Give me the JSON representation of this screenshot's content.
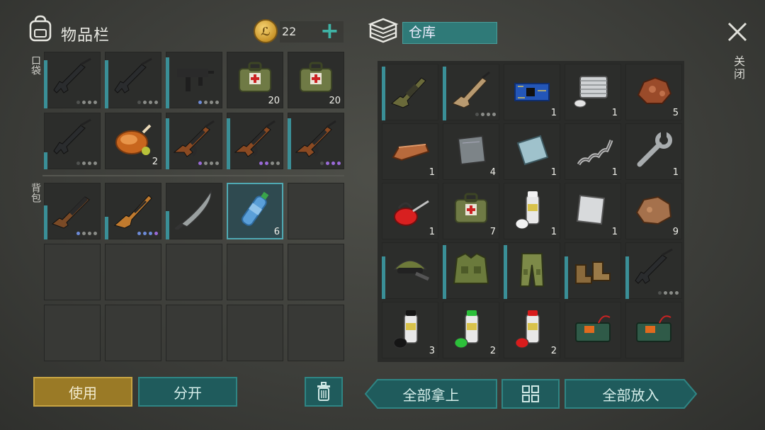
{
  "inventory": {
    "title": "物品栏",
    "coins": "22",
    "pocket_label": "口袋",
    "backpack_label": "背包",
    "pocket_slots": [
      {
        "icon": "assault-rifle-icon",
        "qty": "",
        "dots": [
          "dark",
          "grey",
          "grey",
          "grey"
        ],
        "dur": 0.85
      },
      {
        "icon": "assault-rifle-icon",
        "qty": "",
        "dots": [
          "dark",
          "grey",
          "grey",
          "grey"
        ],
        "dur": 0.85
      },
      {
        "icon": "smg-icon",
        "qty": "",
        "dots": [
          "blue",
          "grey",
          "grey",
          "grey"
        ],
        "dur": 0.9
      },
      {
        "icon": "medkit-bag-icon",
        "qty": "20",
        "dots": [],
        "dur": 0
      },
      {
        "icon": "medkit-bag-icon",
        "qty": "20",
        "dots": [],
        "dur": 0
      },
      {
        "icon": "assault-rifle-icon",
        "qty": "",
        "dots": [
          "dark",
          "grey",
          "grey",
          "grey"
        ],
        "dur": 0.3
      },
      {
        "icon": "roast-chicken-icon",
        "qty": "2",
        "dots": [],
        "dur": 0
      },
      {
        "icon": "ak-rifle-icon",
        "qty": "",
        "dots": [
          "purple",
          "grey",
          "grey",
          "grey"
        ],
        "dur": 0.9
      },
      {
        "icon": "ak-rifle-icon",
        "qty": "",
        "dots": [
          "purple",
          "purple",
          "grey",
          "grey"
        ],
        "dur": 0.9
      },
      {
        "icon": "ak-rifle-icon",
        "qty": "",
        "dots": [
          "dark",
          "purple",
          "purple",
          "purple"
        ],
        "dur": 0.9
      }
    ],
    "backpack_slots": [
      {
        "icon": "shotgun-icon",
        "qty": "",
        "dots": [
          "blue",
          "grey",
          "grey",
          "grey"
        ],
        "dur": 0.6
      },
      {
        "icon": "hunting-rifle-icon",
        "qty": "",
        "dots": [
          "blue",
          "blue",
          "blue",
          "purple"
        ],
        "dur": 0.4
      },
      {
        "icon": "machete-icon",
        "qty": "",
        "dots": [],
        "dur": 0.5
      },
      {
        "icon": "water-bottle-icon",
        "qty": "6",
        "dots": [],
        "dur": 0,
        "selected": true
      },
      {
        "empty": true
      },
      {
        "empty": true
      },
      {
        "empty": true
      },
      {
        "empty": true
      },
      {
        "empty": true
      },
      {
        "empty": true
      },
      {
        "empty": true
      },
      {
        "empty": true
      },
      {
        "empty": true
      },
      {
        "empty": true
      },
      {
        "empty": true
      }
    ]
  },
  "warehouse": {
    "title": "仓库",
    "close_label": "关闭",
    "slots": [
      {
        "icon": "grenade-launcher-rifle-icon",
        "qty": "",
        "dots": [],
        "dur": 0.95
      },
      {
        "icon": "scar-rifle-icon",
        "qty": "",
        "dots": [
          "dark",
          "grey",
          "grey",
          "grey"
        ],
        "dur": 0.95
      },
      {
        "icon": "circuit-board-icon",
        "qty": "1",
        "dots": [],
        "dur": 0
      },
      {
        "icon": "engine-part-icon",
        "qty": "1",
        "dots": [],
        "dur": 0
      },
      {
        "icon": "copper-ore-icon",
        "qty": "5",
        "dots": [],
        "dur": 0
      },
      {
        "icon": "copper-ingot-icon",
        "qty": "1",
        "dots": [],
        "dur": 0
      },
      {
        "icon": "metal-plate-icon",
        "qty": "4",
        "dots": [],
        "dur": 0
      },
      {
        "icon": "glass-plate-icon",
        "qty": "1",
        "dots": [],
        "dur": 0
      },
      {
        "icon": "spring-icon",
        "qty": "1",
        "dots": [],
        "dur": 0
      },
      {
        "icon": "wrench-icon",
        "qty": "1",
        "dots": [],
        "dur": 0
      },
      {
        "icon": "oil-can-icon",
        "qty": "1",
        "dots": [],
        "dur": 0
      },
      {
        "icon": "medkit-bag-icon",
        "qty": "7",
        "dots": [],
        "dur": 0
      },
      {
        "icon": "spray-paint-white-icon",
        "qty": "1",
        "dots": [],
        "dur": 0
      },
      {
        "icon": "steel-sheet-icon",
        "qty": "1",
        "dots": [],
        "dur": 0
      },
      {
        "icon": "iron-ore-icon",
        "qty": "9",
        "dots": [],
        "dur": 0
      },
      {
        "icon": "military-cap-icon",
        "qty": "",
        "dots": [],
        "dur": 0.75
      },
      {
        "icon": "tactical-vest-icon",
        "qty": "",
        "dots": [],
        "dur": 0.95
      },
      {
        "icon": "camo-pants-icon",
        "qty": "",
        "dots": [],
        "dur": 0.95
      },
      {
        "icon": "combat-boots-icon",
        "qty": "",
        "dots": [],
        "dur": 0.75
      },
      {
        "icon": "m16-rifle-icon",
        "qty": "",
        "dots": [
          "dark",
          "grey",
          "grey",
          "grey"
        ],
        "dur": 0.75
      },
      {
        "icon": "spray-paint-black-icon",
        "qty": "3",
        "dots": [],
        "dur": 0
      },
      {
        "icon": "spray-paint-green-icon",
        "qty": "2",
        "dots": [],
        "dur": 0
      },
      {
        "icon": "spray-paint-red-icon",
        "qty": "2",
        "dots": [],
        "dur": 0
      },
      {
        "icon": "explosive-charge-icon",
        "qty": "",
        "dots": [],
        "dur": 0
      },
      {
        "icon": "explosive-charge-icon",
        "qty": "",
        "dots": [],
        "dur": 0
      }
    ]
  },
  "buttons": {
    "use": "使用",
    "split": "分开",
    "take_all": "全部拿上",
    "put_all": "全部放入"
  },
  "colors": {
    "accent": "#3fb3a6",
    "use_button": "#9a7a26",
    "teal_button": "#1f5b5c"
  }
}
